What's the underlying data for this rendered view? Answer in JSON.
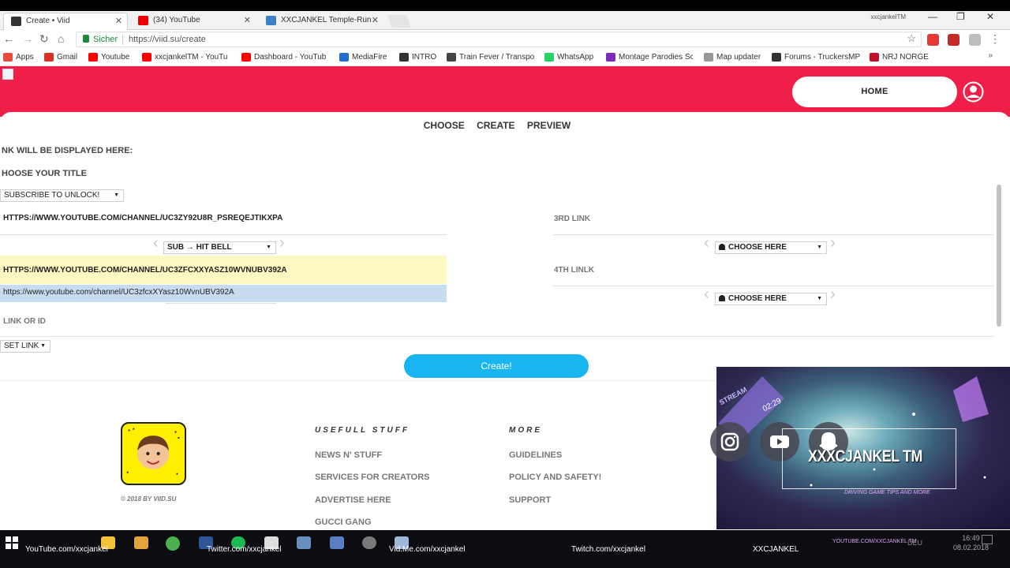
{
  "browser": {
    "tabs": [
      {
        "title": "Create • Viid",
        "active": true
      },
      {
        "title": "(34) YouTube",
        "active": false
      },
      {
        "title": "XXCJANKEL Temple-Run",
        "active": false
      }
    ],
    "profile_name": "xxcjankelTM",
    "secure_label": "Sicher",
    "url": "https://viid.su/create",
    "bookmarks": [
      {
        "label": "Apps",
        "color": "#e74c3c"
      },
      {
        "label": "Gmail",
        "color": "#d93025"
      },
      {
        "label": "Youtube",
        "color": "#ff0000"
      },
      {
        "label": "xxcjankelTM - YouTu",
        "color": "#ff0000"
      },
      {
        "label": "Dashboard - YouTub",
        "color": "#ff0000"
      },
      {
        "label": "MediaFire",
        "color": "#1f6fd0"
      },
      {
        "label": "INTRO",
        "color": "#333333"
      },
      {
        "label": "Train Fever / Transpo",
        "color": "#444444"
      },
      {
        "label": "WhatsApp",
        "color": "#25d366"
      },
      {
        "label": "Montage Parodies Sc",
        "color": "#7b2cbf"
      },
      {
        "label": "Map updater",
        "color": "#999999"
      },
      {
        "label": "Forums - TruckersMP",
        "color": "#333333"
      },
      {
        "label": "NRJ NORGE",
        "color": "#c0102b"
      }
    ]
  },
  "site": {
    "home_label": "HOME",
    "steps": [
      "CHOOSE",
      "CREATE",
      "PREVIEW"
    ],
    "link_display_label": "NK WILL BE DISPLAYED HERE:",
    "title_label": "HOOSE YOUR TITLE",
    "title_select": "SUBSCRIBE TO UNLOCK!",
    "link1_value": "HTTPS://WWW.YOUTUBE.COM/CHANNEL/UC3ZY92U8R_PSREQEJTIKXPA",
    "link1_action": "SUB → HIT BELL",
    "link2_value": "HTTPS://WWW.YOUTUBE.COM/CHANNEL/UC3ZFCXXYASZ10WVNUBV392A",
    "autocomplete_suggestion": "https://www.youtube.com/channel/UC3zfcxXYasz10WvnUBV392A",
    "link_or_id_label": "LINK OR ID",
    "set_link_select": "SET LINK",
    "third_link_label": "3RD LINK",
    "fourth_link_label": "4TH LINLK",
    "choose_here": "CHOOSE HERE",
    "create_button": "Create!",
    "footer": {
      "copyright": "© 2018 BY VIID.SU",
      "useful_heading": "USEFULL STUFF",
      "useful_links": [
        "NEWS N' STUFF",
        "SERVICES FOR CREATORS",
        "ADVERTISE HERE",
        "GUCCI GANG"
      ],
      "more_heading": "MORE",
      "more_links": [
        "GUIDELINES",
        "POLICY AND SAFETY!",
        "SUPPORT"
      ]
    },
    "accent_color": "#ef1f4a",
    "button_color": "#19b5f0"
  },
  "overlay": {
    "channel_name": "XXXCJANKEL TM",
    "stream_text": "STREAM",
    "clock": "02:29",
    "subtitle": "DRIVING GAME TIPS AND MORE"
  },
  "taskbar": {
    "social": [
      "YouTube.com/xxcjankel",
      "Twitter.com/xxcjankel",
      "Vid.Me.com/xxcjankel",
      "Twitch.com/xxcjankel",
      "XXCJANKEL"
    ],
    "ticker": "YOUTUBE.COM/XXCJANKEL TM",
    "language": "DEU",
    "time": "16:49",
    "date": "08.02.2018"
  }
}
